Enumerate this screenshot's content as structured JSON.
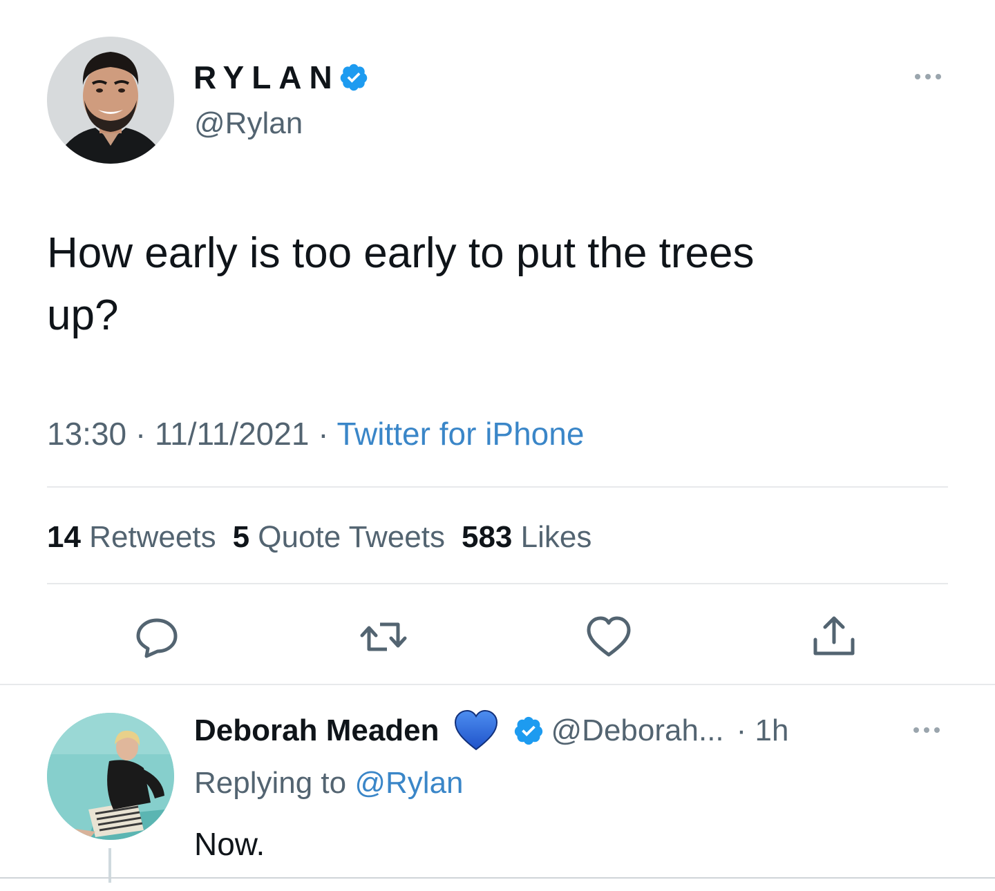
{
  "tweet": {
    "author": {
      "display_name": "RYLAN",
      "handle": "@Rylan",
      "verified": true
    },
    "more_icon": "more-horizontal-icon",
    "text_line1": "How early is too early to put the trees",
    "text_line2": "up?",
    "meta": {
      "time": "13:30",
      "separator": " · ",
      "date": "11/11/2021",
      "source": "Twitter for iPhone"
    },
    "stats": {
      "retweets_count": "14",
      "retweets_label": " Retweets",
      "quotes_count": "5",
      "quotes_label": " Quote Tweets",
      "likes_count": "583",
      "likes_label": " Likes"
    },
    "actions": [
      "reply-icon",
      "retweet-icon",
      "like-icon",
      "share-icon"
    ]
  },
  "reply": {
    "author": {
      "display_name": "Deborah Meaden",
      "emoji": "blue-heart-emoji",
      "verified": true,
      "handle": "@Deborah...",
      "time": "· 1h"
    },
    "replying_prefix": "Replying to ",
    "replying_mention": "@Rylan",
    "text": "Now."
  },
  "colors": {
    "verified": "#1d9bf0",
    "link": "#3a86c8",
    "secondary_text": "#536471",
    "primary_text": "#0f1419",
    "heart_emoji": "#2f6fe0"
  }
}
